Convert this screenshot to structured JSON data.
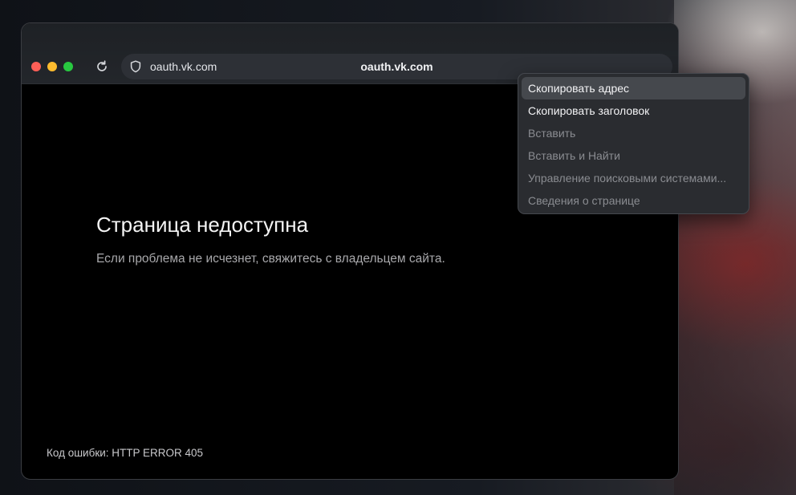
{
  "browser": {
    "address_host": "oauth.vk.com",
    "address_center": "oauth.vk.com"
  },
  "page": {
    "title": "Страница недоступна",
    "description": "Если проблема не исчезнет, свяжитесь с владельцем сайта.",
    "error_code": "Код ошибки: HTTP ERROR 405"
  },
  "context_menu": {
    "items": [
      {
        "label": "Скопировать адрес",
        "enabled": true,
        "highlighted": true
      },
      {
        "label": "Скопировать заголовок",
        "enabled": true,
        "highlighted": false
      },
      {
        "label": "Вставить",
        "enabled": false,
        "highlighted": false
      },
      {
        "label": "Вставить и Найти",
        "enabled": false,
        "highlighted": false
      },
      {
        "label": "Управление поисковыми системами...",
        "enabled": false,
        "highlighted": false
      },
      {
        "label": "Сведения о странице",
        "enabled": false,
        "highlighted": false
      }
    ]
  },
  "icons": {
    "reload": "reload-icon",
    "site_info": "shield-icon"
  },
  "colors": {
    "traffic_close": "#ff5f57",
    "traffic_minimize": "#febc2e",
    "traffic_maximize": "#28c840"
  }
}
